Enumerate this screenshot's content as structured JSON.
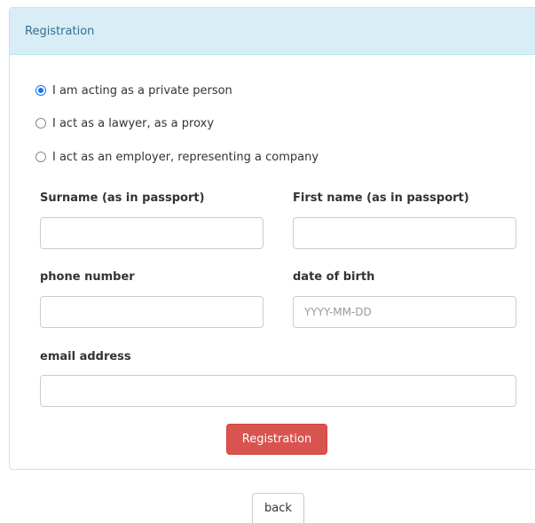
{
  "panel": {
    "title": "Registration"
  },
  "role_options": [
    {
      "label": "I am acting as a private person",
      "checked": true
    },
    {
      "label": "I act as a lawyer, as a proxy",
      "checked": false
    },
    {
      "label": "I act as an employer, representing a company",
      "checked": false
    }
  ],
  "form": {
    "surname": {
      "label": "Surname (as in passport)",
      "value": "",
      "placeholder": ""
    },
    "first_name": {
      "label": "First name (as in passport)",
      "value": "",
      "placeholder": ""
    },
    "phone": {
      "label": "phone number",
      "value": "",
      "placeholder": ""
    },
    "date_of_birth": {
      "label": "date of birth",
      "value": "",
      "placeholder": "YYYY-MM-DD"
    },
    "email": {
      "label": "email address",
      "value": "",
      "placeholder": ""
    }
  },
  "actions": {
    "submit_label": "Registration",
    "back_label": "back"
  },
  "colors": {
    "heading_background": "#d9edf7",
    "heading_text": "#31708f",
    "submit_button": "#d9534f",
    "radio_selected": "#1a73e8"
  }
}
